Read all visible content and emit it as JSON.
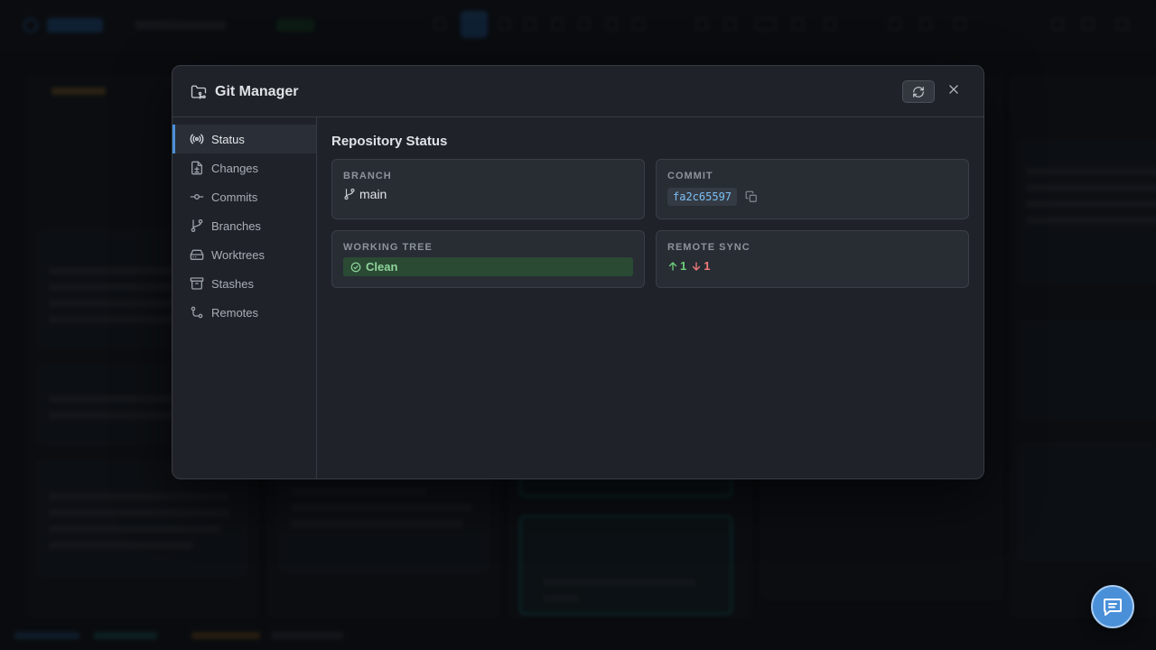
{
  "modal": {
    "title": "Git Manager",
    "refresh_icon": "refresh-icon",
    "close_icon": "close-icon"
  },
  "sidebar": {
    "items": [
      {
        "label": "Status",
        "icon": "broadcast-icon",
        "active": true
      },
      {
        "label": "Changes",
        "icon": "file-diff-icon",
        "active": false
      },
      {
        "label": "Commits",
        "icon": "commit-icon",
        "active": false
      },
      {
        "label": "Branches",
        "icon": "branch-icon",
        "active": false
      },
      {
        "label": "Worktrees",
        "icon": "drive-icon",
        "active": false
      },
      {
        "label": "Stashes",
        "icon": "archive-icon",
        "active": false
      },
      {
        "label": "Remotes",
        "icon": "remote-icon",
        "active": false
      }
    ]
  },
  "status": {
    "section_title": "Repository Status",
    "branch": {
      "label": "BRANCH",
      "value": "main"
    },
    "commit": {
      "label": "COMMIT",
      "value": "fa2c65597"
    },
    "working_tree": {
      "label": "WORKING TREE",
      "value": "Clean"
    },
    "remote_sync": {
      "label": "REMOTE SYNC",
      "ahead": "1",
      "behind": "1"
    }
  },
  "colors": {
    "accent": "#4a90d9",
    "clean_text": "#8fd49a",
    "ahead": "#6fcf7c",
    "behind": "#f07a7a",
    "commit_hash": "#7cc1f5"
  }
}
